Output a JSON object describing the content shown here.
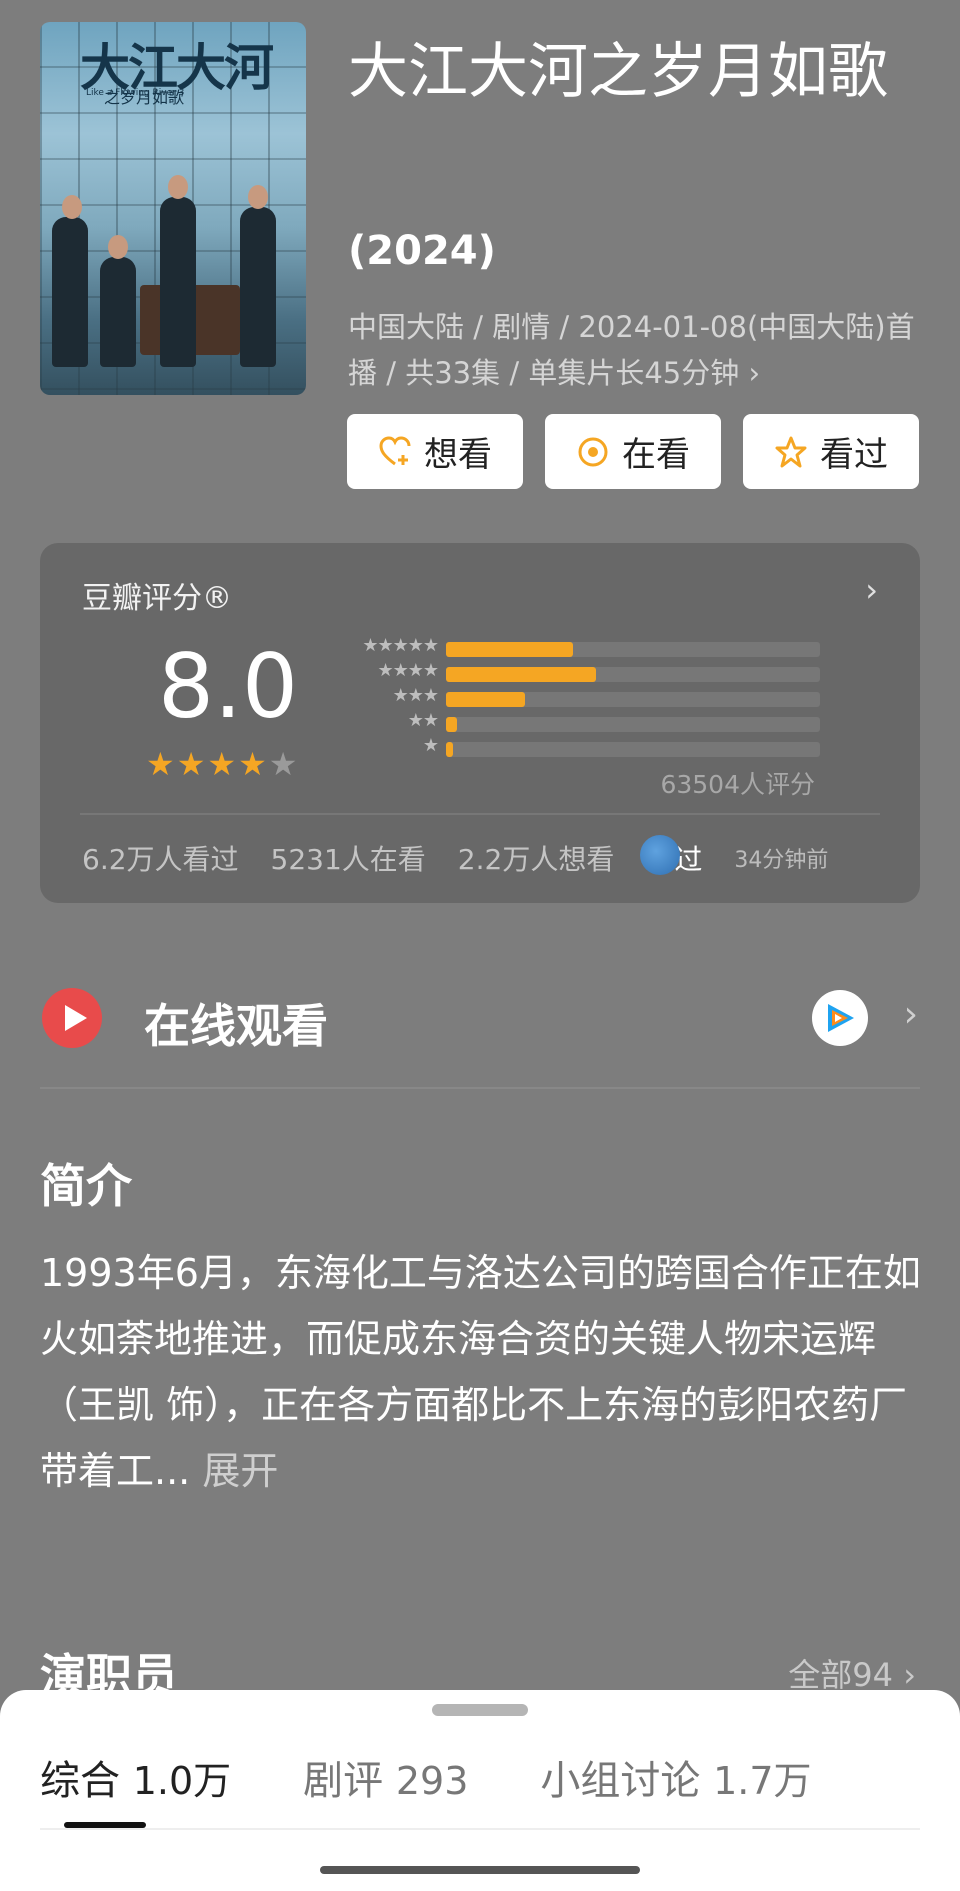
{
  "poster": {
    "logo": "大江大河",
    "subtitle": "之岁月如歌",
    "english": "Like a Flowing River 3"
  },
  "title": "大江大河之岁月如歌",
  "year": "(2024)",
  "meta": "中国大陆 / 剧情 / 2024-01-08(中国大陆)首播 / 共33集 / 单集片长45分钟",
  "meta_chevron": "›",
  "buttons": {
    "want": "想看",
    "watching": "在看",
    "watched": "看过"
  },
  "rating": {
    "label": "豆瓣评分®",
    "score": "8.0",
    "stars": 4,
    "distribution": [
      {
        "stars": "★★★★★",
        "fraction": 0.34
      },
      {
        "stars": "★★★★",
        "fraction": 0.4
      },
      {
        "stars": "★★★",
        "fraction": 0.21
      },
      {
        "stars": "★★",
        "fraction": 0.03
      },
      {
        "stars": "★",
        "fraction": 0.02
      }
    ],
    "count": "63504人评分",
    "watched": "6.2万人看过",
    "watching": "5231人在看",
    "want": "2.2万人想看",
    "my_status": "看过",
    "my_time": "34分钟前"
  },
  "online": {
    "label": "在线观看",
    "chevron": "›"
  },
  "intro": {
    "heading": "简介",
    "text": "1993年6月，东海化工与洛达公司的跨国合作正在如火如荼地推进，而促成东海合资的关键人物宋运辉（王凯 饰），正在各方面都比不上东海的彭阳农药厂带着工...",
    "expand": "展开"
  },
  "cast": {
    "heading": "演职员",
    "all": "全部94 ›"
  },
  "tabs": [
    {
      "label": "综合",
      "count": "1.0万"
    },
    {
      "label": "剧评",
      "count": "293"
    },
    {
      "label": "小组讨论",
      "count": "1.7万"
    }
  ],
  "colors": {
    "accent": "#f5a623",
    "play": "#e84b4b"
  }
}
